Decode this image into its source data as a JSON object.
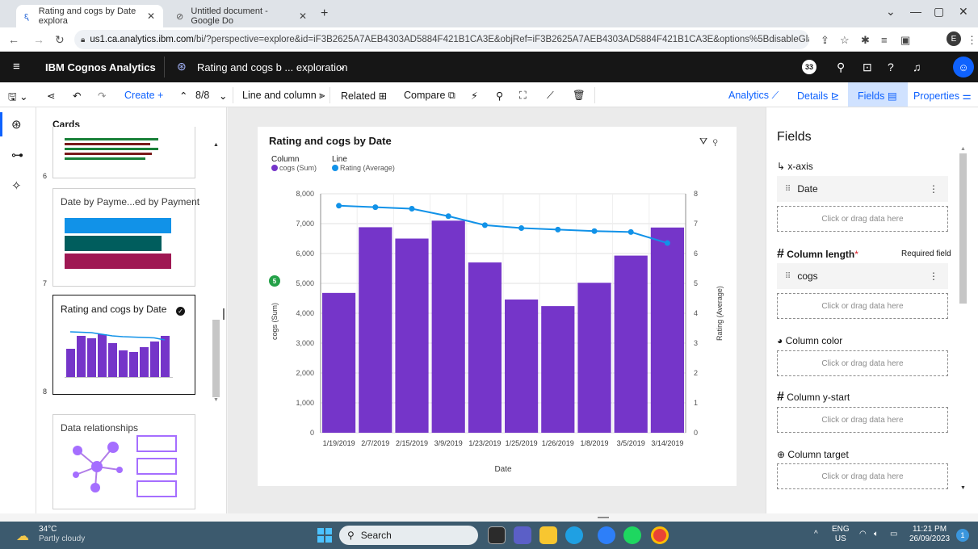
{
  "browser": {
    "tabs": [
      {
        "label": "Rating and cogs by Date explora",
        "active": true
      },
      {
        "label": "Untitled document - Google Do",
        "active": false
      }
    ],
    "url_host": "us1.ca.analytics.ibm.com",
    "url_path": "/bi/?perspective=explore&id=iF3B2625A7AEB4303AD5884F421B1CA3E&objRef=iF3B2625A7AEB4303AD5884F421B1CA3E&options%5BdisableGlassPrefetch%5...",
    "profile_initial": "E"
  },
  "app": {
    "brand": "IBM Cognos Analytics",
    "exploration_title": "Rating and cogs b ... exploration",
    "notification_count": "33"
  },
  "toolbar": {
    "create_label": "Create",
    "page_counter": "8/8",
    "viz_type": "Line and column",
    "related_label": "Related",
    "compare_label": "Compare",
    "analytics_label": "Analytics",
    "details_label": "Details",
    "fields_label": "Fields",
    "properties_label": "Properties"
  },
  "cards_panel": {
    "title": "Cards",
    "cards": [
      {
        "number": "6",
        "title": ""
      },
      {
        "number": "7",
        "title": "Date by Payme...ed by Payment"
      },
      {
        "number": "8",
        "title": "Rating and cogs by Date"
      },
      {
        "number": "",
        "title": "Data relationships"
      }
    ]
  },
  "chart_data": {
    "type": "bar",
    "title": "Rating and cogs by Date",
    "legend": {
      "column_heading": "Column",
      "line_heading": "Line"
    },
    "categories": [
      "1/19/2019",
      "2/7/2019",
      "2/15/2019",
      "3/9/2019",
      "1/23/2019",
      "1/25/2019",
      "1/26/2019",
      "1/8/2019",
      "3/5/2019",
      "3/14/2019"
    ],
    "series": [
      {
        "name": "cogs (Sum)",
        "kind": "column",
        "axis": "left",
        "color": "#7535c9",
        "values": [
          4680,
          6880,
          6500,
          7100,
          5700,
          4460,
          4240,
          5020,
          5930,
          6870
        ]
      },
      {
        "name": "Rating (Average)",
        "kind": "line",
        "axis": "right",
        "color": "#1192e8",
        "values": [
          7.6,
          7.55,
          7.5,
          7.25,
          6.95,
          6.85,
          6.8,
          6.75,
          6.72,
          6.35
        ]
      }
    ],
    "xlabel": "Date",
    "ylabel": "cogs (Sum)",
    "y2label": "Rating (Average)",
    "ylim": [
      0,
      8000
    ],
    "y2lim": [
      0,
      8
    ],
    "yticks": [
      "0",
      "1,000",
      "2,000",
      "3,000",
      "4,000",
      "5,000",
      "6,000",
      "7,000",
      "8,000"
    ],
    "y2ticks": [
      "0",
      "1",
      "2",
      "3",
      "4",
      "5",
      "6",
      "7",
      "8"
    ],
    "y_badge": "5",
    "grid": true
  },
  "fields_panel": {
    "title": "Fields",
    "xaxis_label": "x-axis",
    "xaxis_field": "Date",
    "drop_hint": "Click or drag data here",
    "column_length_label": "Column length",
    "required_mark": "*",
    "required_text": "Required field",
    "column_length_field": "cogs",
    "column_color_label": "Column color",
    "column_ystart_label": "Column y-start",
    "column_target_label": "Column target"
  },
  "taskbar": {
    "temperature": "34°C",
    "weather": "Partly cloudy",
    "search_placeholder": "Search",
    "lang": "ENG",
    "region": "US",
    "time": "11:21 PM",
    "date": "26/09/2023",
    "notifications": "1"
  }
}
